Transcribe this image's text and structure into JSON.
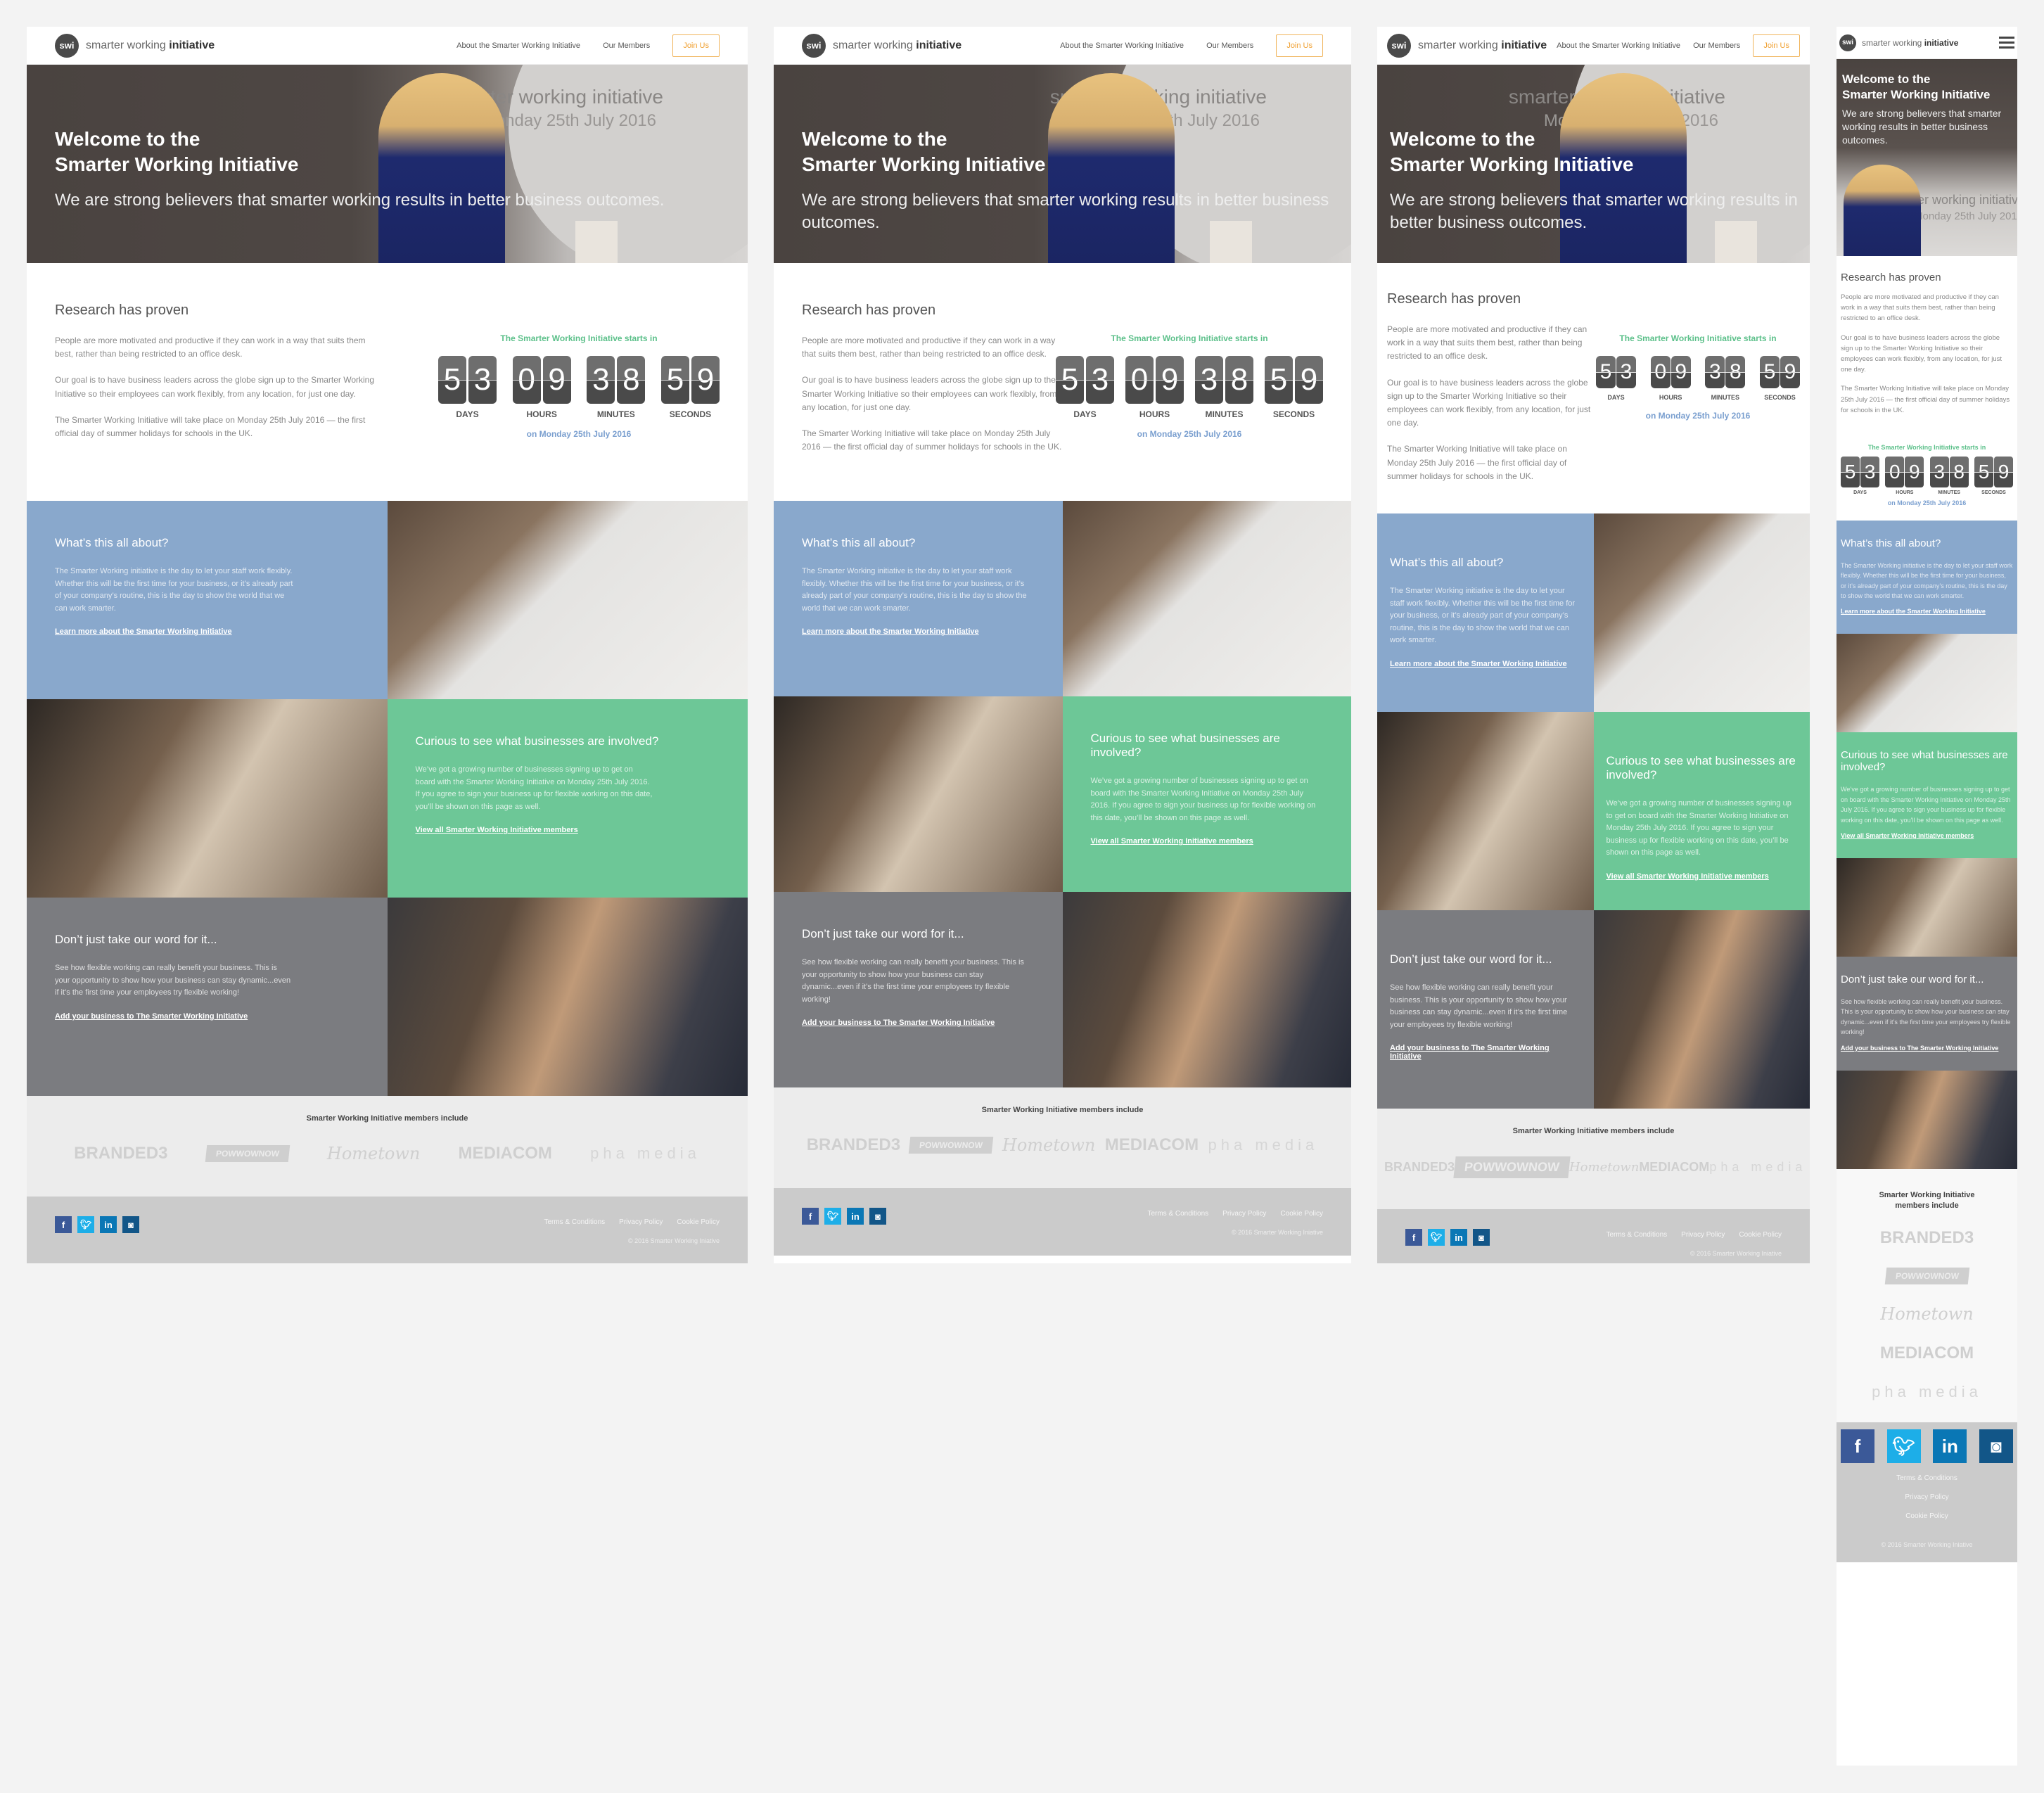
{
  "brand": {
    "logo_mark": "swi",
    "logo_text_light": "smarter working ",
    "logo_text_bold": "initiative"
  },
  "nav": {
    "about": "About the Smarter Working Initiative",
    "members": "Our Members",
    "join": "Join Us"
  },
  "hero": {
    "title_line1": "Welcome to the",
    "title_line2": "Smarter Working Initiative",
    "subtitle": "We are strong believers that smarter working results in better business outcomes.",
    "stage_text": "smarter working initiative",
    "stage_date": "Monday 25th July 2016"
  },
  "research": {
    "heading": "Research has proven",
    "paragraphs": [
      "People are more motivated and productive if they can work in a way that suits them best, rather than being restricted to an office desk.",
      "Our goal is to have business leaders across the globe sign up to the Smarter Working Initiative so their employees can work flexibly, from any location, for just one day.",
      "The Smarter Working Initiative will take place on Monday 25th July 2016 — the first official day of summer holidays for schools in the UK."
    ]
  },
  "countdown": {
    "title": "The Smarter Working Initiative starts in",
    "units": [
      {
        "digits": [
          "5",
          "3"
        ],
        "label": "DAYS"
      },
      {
        "digits": [
          "0",
          "9"
        ],
        "label": "HOURS"
      },
      {
        "digits": [
          "3",
          "8"
        ],
        "label": "MINUTES"
      },
      {
        "digits": [
          "5",
          "9"
        ],
        "label": "SECONDS"
      }
    ],
    "date": "on Monday 25th July 2016"
  },
  "tiles": {
    "about": {
      "heading": "What’s this all about?",
      "body": "The Smarter Working initiative is the day to let your staff work flexibly.  Whether this will be the first time for your business, or it’s already part of your company’s routine, this is the day to show the world that we can work smarter.",
      "link": "Learn more about the Smarter Working Initiative"
    },
    "businesses": {
      "heading": "Curious to see what businesses are involved?",
      "body": "We’ve got a growing number of businesses signing up to get on board with the Smarter Working Initiative on Monday 25th July 2016.  If you agree to sign your business up for flexible working on this date, you’ll be shown on this page as well.",
      "link": "View all Smarter Working Initiative members"
    },
    "word": {
      "heading": "Don’t just take our word for it...",
      "body": "See how flexible working can really benefit your business.  This is your opportunity to show how your business can stay dynamic...even if it’s the first time your employees try flexible working!",
      "link": "Add your business to The Smarter Working Initiative"
    }
  },
  "members": {
    "title": "Smarter Working Initiative members include",
    "logos": [
      "BRANDED3",
      "POWWOWNOW",
      "Hometown",
      "MEDIACOM",
      "pha media"
    ]
  },
  "footer": {
    "social": [
      "f",
      "t",
      "in",
      "ig"
    ],
    "links": [
      "Terms & Conditions",
      "Privacy Policy",
      "Cookie Policy"
    ],
    "copyright": "© 2016 Smarter Working Iniative"
  },
  "colors": {
    "blue_tile": "#89a8cc",
    "green_tile": "#6dc797",
    "grey_tile": "#7b7c80",
    "join_accent": "#f0a030",
    "countdown_title": "#5cc08a",
    "countdown_date": "#7a9fcf"
  }
}
